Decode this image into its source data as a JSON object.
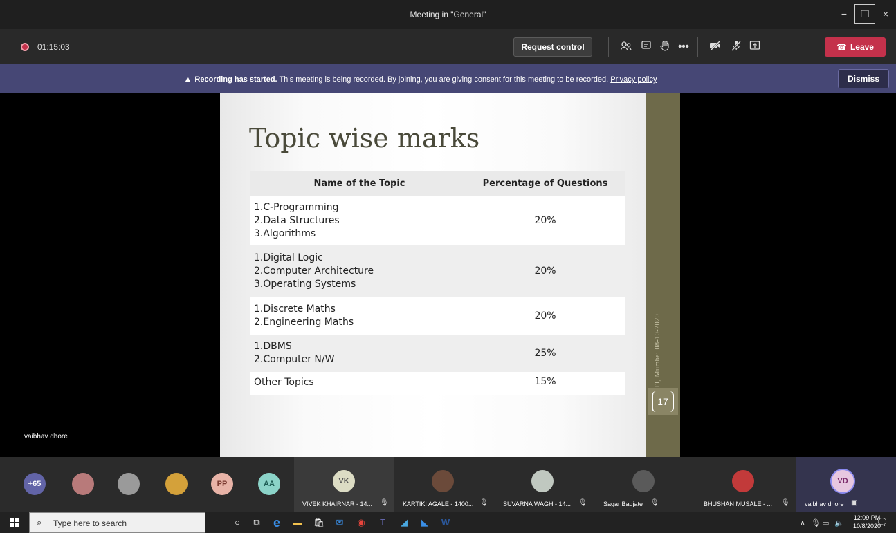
{
  "window": {
    "title": "Meeting in \"General\"",
    "minimize": "−",
    "maximize": "❐",
    "close": "×"
  },
  "toolbar": {
    "timer": "01:15:03",
    "request_control": "Request control",
    "leave": "Leave",
    "icons": [
      "participants-icon",
      "chat-icon",
      "raise-hand-icon",
      "more-icon",
      "camera-off-icon",
      "mic-off-icon",
      "share-icon"
    ]
  },
  "banner": {
    "bold": "Recording has started.",
    "text": " This meeting is being recorded. By joining, you are giving consent for this meeting to be recorded. ",
    "link": "Privacy policy",
    "dismiss": "Dismiss"
  },
  "slide": {
    "title": "Topic wise marks",
    "headers": [
      "Name of the Topic",
      "Percentage of Questions"
    ],
    "rows": [
      {
        "topics": [
          "1.C-Programming",
          "2.Data Structures",
          "3.Algorithms"
        ],
        "pct": "20%"
      },
      {
        "topics": [
          "1.Digital Logic",
          "2.Computer Architecture",
          "3.Operating Systems"
        ],
        "pct": "20%"
      },
      {
        "topics": [
          "1.Discrete Maths",
          "2.Engineering Maths"
        ],
        "pct": "20%"
      },
      {
        "topics": [
          "1.DBMS",
          "2.Computer N/W"
        ],
        "pct": "25%"
      },
      {
        "topics": [
          "Other Topics"
        ],
        "pct": "15%"
      }
    ],
    "side_text": "VJTI, Mumbai    08-10-2020",
    "page_number": "17"
  },
  "presenter": {
    "name": "vaibhav dhore"
  },
  "roster": {
    "overflow": "+65",
    "initials": {
      "pp": "PP",
      "aa": "AA",
      "vk": "VK",
      "vd": "VD"
    },
    "participants": [
      "VIVEK KHAIRNAR - 14...",
      "KARTIKI AGALE - 1400...",
      "SUVARNA WAGH - 14...",
      "Sagar Badjate",
      "BHUSHAN MUSALE - ...",
      "vaibhav dhore"
    ],
    "colors": {
      "pp": "#e8b3a7",
      "aa": "#8bd3c8",
      "vk": "#dcdcc4",
      "vd": "#e7c7e0",
      "overflow": "#6264a7"
    }
  },
  "taskbar": {
    "search_placeholder": "Type here to search",
    "time": "12:09 PM",
    "date": "10/8/2020"
  }
}
